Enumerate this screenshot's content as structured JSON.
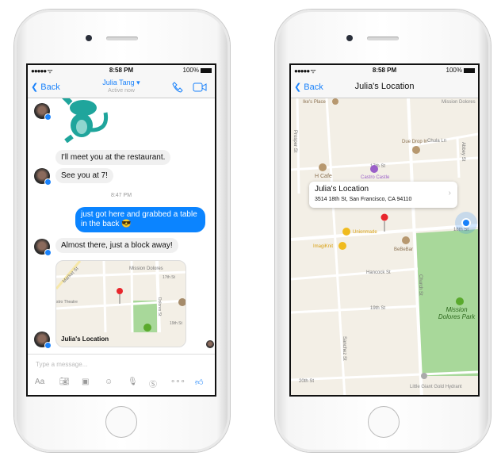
{
  "status": {
    "signal": "●●●●● ᯤ",
    "time": "8:58 PM",
    "battery": "100%"
  },
  "chat": {
    "back": "Back",
    "contact": "Julia Tang ▾",
    "presence": "Active now",
    "icons": {
      "call": "phone-icon",
      "video": "video-camera-icon"
    },
    "messages": [
      {
        "from": "Julia",
        "type": "sticker",
        "icon": "monkey-sticker"
      },
      {
        "from": "Julia",
        "text": "I'll meet you at the restaurant."
      },
      {
        "from": "Julia",
        "text": "See you at 7!"
      },
      {
        "type": "timestamp",
        "text": "8:47 PM"
      },
      {
        "from": "me",
        "text": "just got here and grabbed a table in the back 😎"
      },
      {
        "from": "Julia",
        "text": "Almost there, just a block away!"
      },
      {
        "from": "Julia",
        "type": "location",
        "title": "Julia's Location",
        "map_labels": [
          "Market St",
          "Mission Dolores",
          "17th St",
          "stro Theatre",
          "Dolores St",
          "19th St",
          "Church St"
        ]
      }
    ],
    "input_placeholder": "Type a message...",
    "toolbar": [
      "Aa",
      "camera-icon",
      "photo-icon",
      "smiley-icon",
      "microphone-icon",
      "dollar-icon",
      "more-icon",
      "thumbs-up-icon"
    ],
    "accent": "#0b84ff"
  },
  "location": {
    "back": "Back",
    "title": "Julia's Location",
    "callout": {
      "title": "Julia's Location",
      "address": "3514 18th St, San Francisco, CA 94110"
    },
    "streets": [
      "Prosper St",
      "17th St",
      "18th St",
      "Hancock St",
      "19th St",
      "20th St",
      "Church St",
      "Sanchez St",
      "Abbey St",
      "Chula Ln"
    ],
    "places": [
      "Ike's Place",
      "Mission Dolores",
      "Due Drop In",
      "H Cafe",
      "Castro Castle",
      "Unionmade",
      "ImagiKnit",
      "BeBeBar",
      "Mission Dolores Park",
      "Little Giant Gold Hydrant"
    ]
  }
}
